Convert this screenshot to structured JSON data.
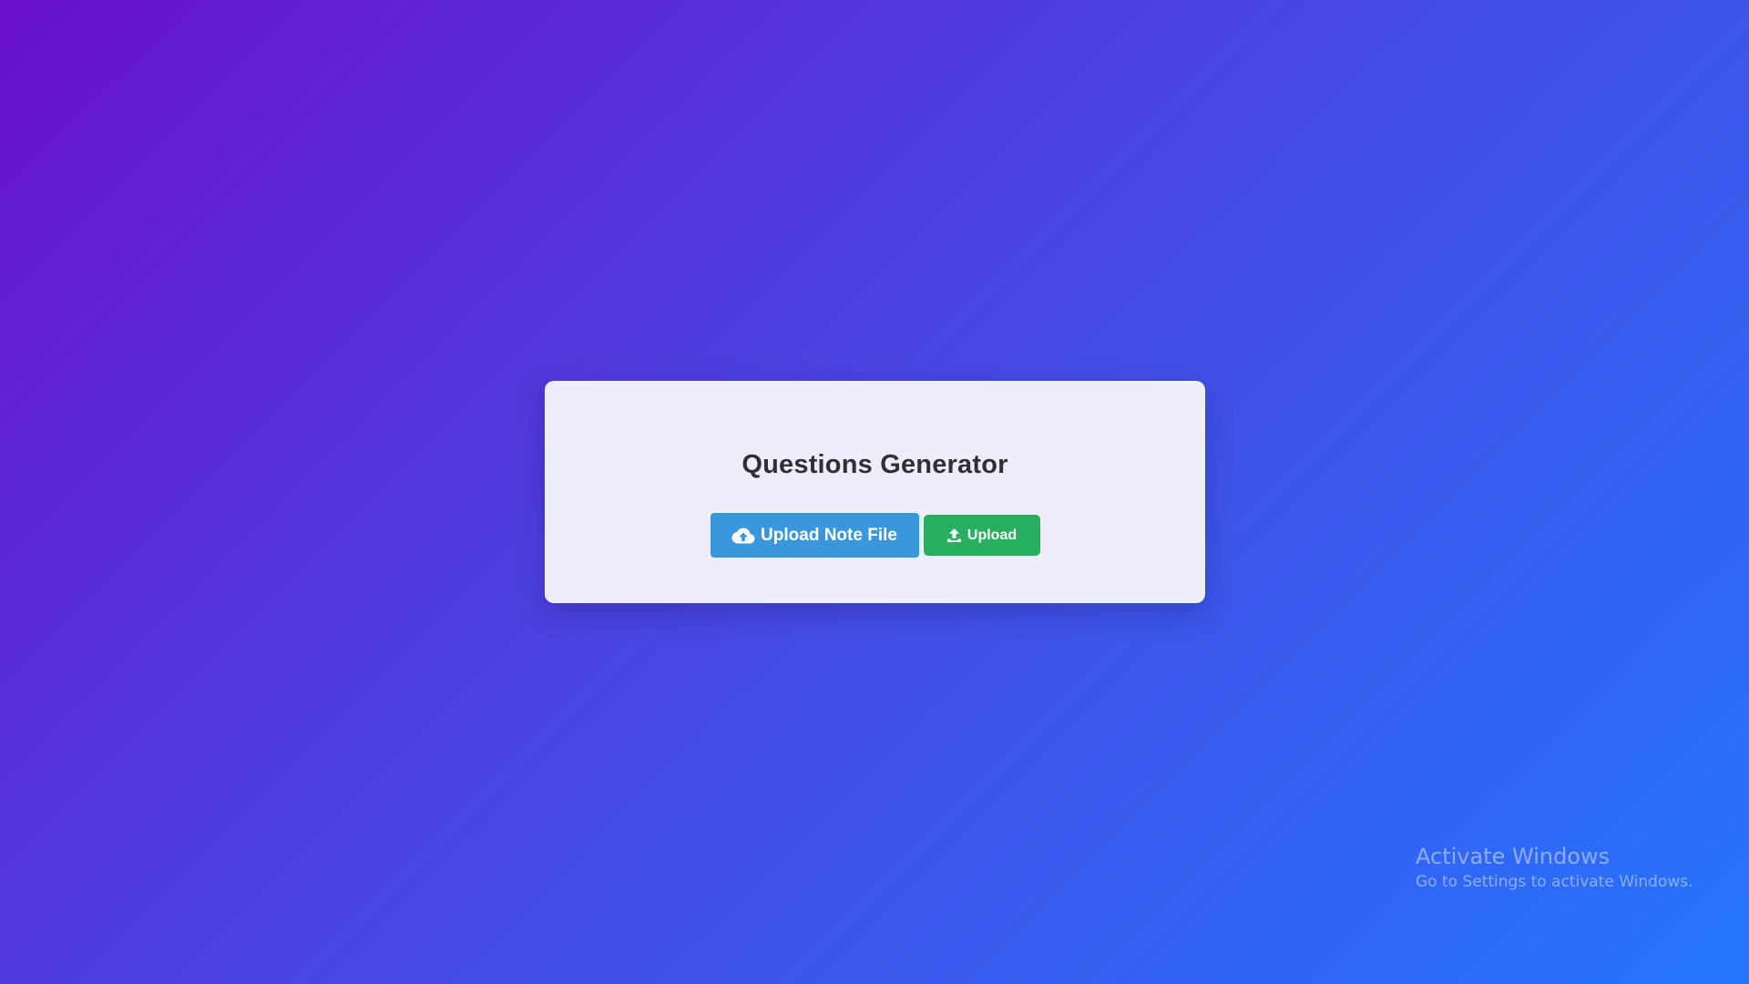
{
  "app": {
    "title": "Questions Generator"
  },
  "actions": {
    "choose_label": "Upload Note File",
    "choose_icon": "cloud-upload-icon",
    "upload_label": "Upload",
    "upload_icon": "upload-icon"
  },
  "watermark": {
    "title": "Activate Windows",
    "subtitle": "Go to Settings to activate Windows."
  },
  "colors": {
    "background_start": "#6a11cb",
    "background_end": "#2575fc",
    "card": "#eeeefa",
    "choose_button": "#3a97dc",
    "upload_button": "#27ae60",
    "title_text": "#2f2f3a"
  }
}
